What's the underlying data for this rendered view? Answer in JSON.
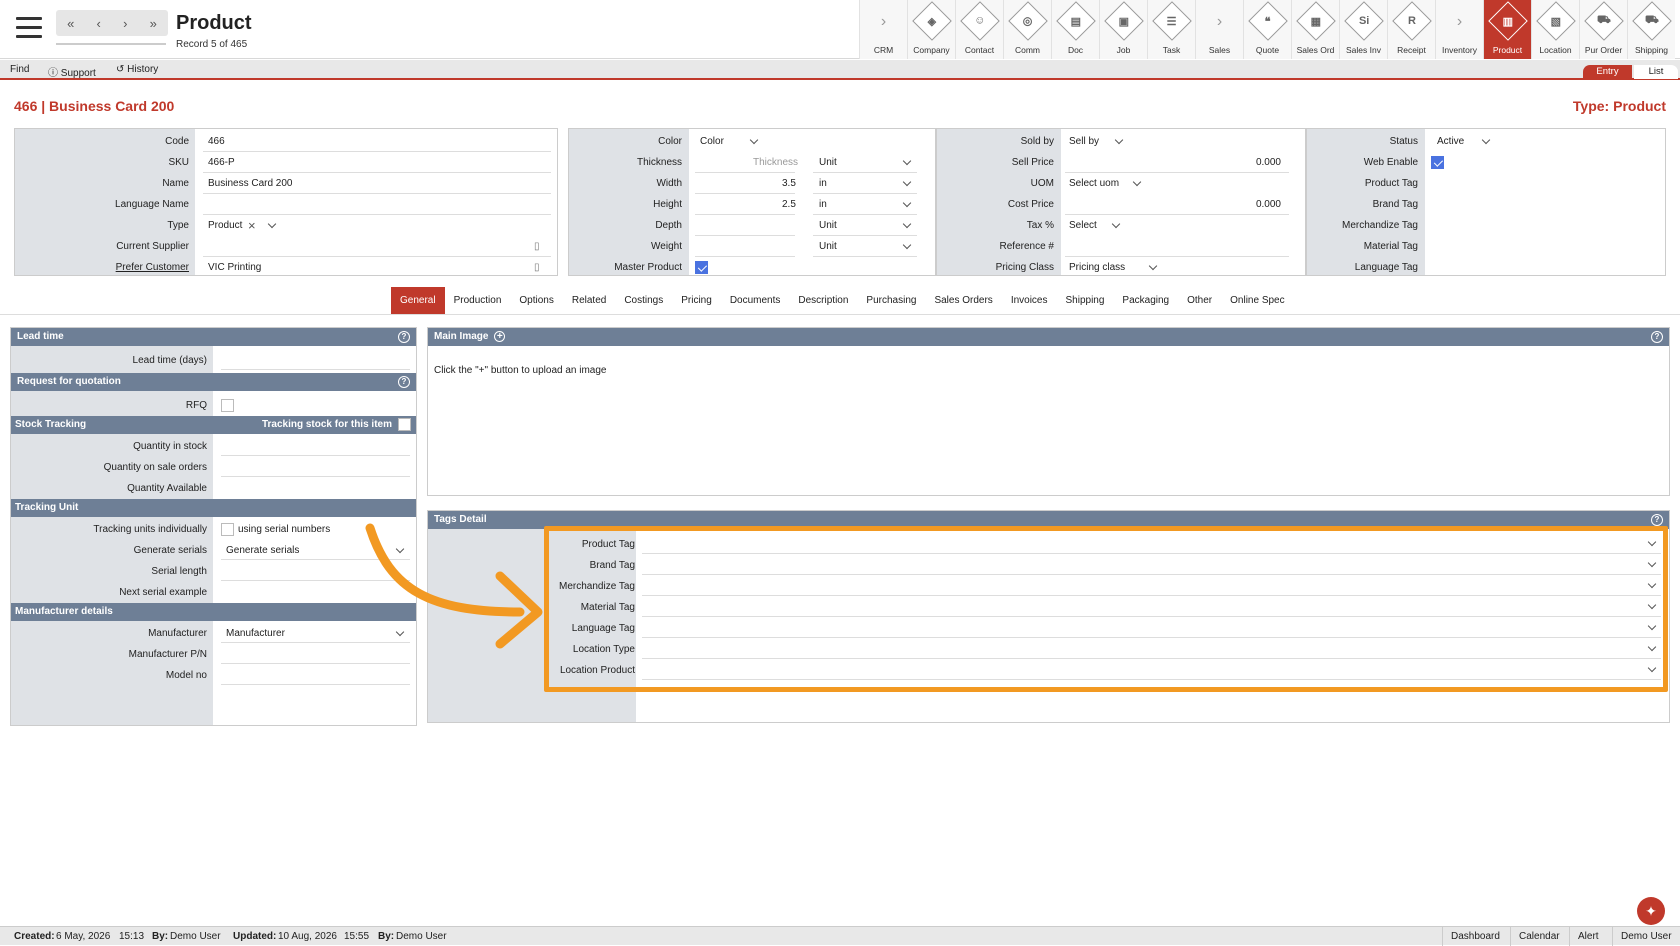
{
  "header": {
    "title": "Product",
    "record": "Record 5 of 465",
    "nav": {
      "first": "«",
      "prev": "‹",
      "next": "›",
      "last": "»"
    }
  },
  "modules": [
    {
      "label": "CRM",
      "type": "arrow",
      "glyph": "›"
    },
    {
      "label": "Company",
      "glyph": "◈"
    },
    {
      "label": "Contact",
      "glyph": "☺"
    },
    {
      "label": "Comm",
      "glyph": "◎"
    },
    {
      "label": "Doc",
      "glyph": "▤"
    },
    {
      "label": "Job",
      "glyph": "▣"
    },
    {
      "label": "Task",
      "glyph": "☰"
    },
    {
      "label": "Sales",
      "type": "arrow",
      "glyph": "›"
    },
    {
      "label": "Quote",
      "glyph": "❝"
    },
    {
      "label": "Sales Ord",
      "glyph": "▦"
    },
    {
      "label": "Sales Inv",
      "glyph": "Si"
    },
    {
      "label": "Receipt",
      "glyph": "R"
    },
    {
      "label": "Inventory",
      "type": "arrow",
      "glyph": "›"
    },
    {
      "label": "Product",
      "glyph": "▥",
      "active": true
    },
    {
      "label": "Location",
      "glyph": "▧"
    },
    {
      "label": "Pur Order",
      "glyph": "⛟"
    },
    {
      "label": "Shipping",
      "glyph": "⛟"
    }
  ],
  "toolbar": {
    "find": "Find",
    "support": "Support",
    "history": "History",
    "support_icon": "ⓘ",
    "history_icon": "↺",
    "entry": "Entry",
    "list": "List"
  },
  "record": {
    "title": "466 | Business Card 200",
    "type": "Type: Product"
  },
  "panel1": {
    "code_label": "Code",
    "code": "466",
    "sku_label": "SKU",
    "sku": "466-P",
    "name_label": "Name",
    "name": "Business Card 200",
    "language_label": "Language Name",
    "language": "",
    "type_label": "Type",
    "type": "Product",
    "type_clear": "×",
    "supplier_label": "Current Supplier",
    "supplier": "",
    "customer_label": "Prefer Customer",
    "customer": "VIC Printing"
  },
  "panel2": {
    "color_label": "Color",
    "color": "Color",
    "thickness_label": "Thickness",
    "thickness_placeholder": "Thickness",
    "thickness_unit": "Unit",
    "width_label": "Width",
    "width": "3.5",
    "width_unit": "in",
    "height_label": "Height",
    "height": "2.5",
    "height_unit": "in",
    "depth_label": "Depth",
    "depth_unit": "Unit",
    "weight_label": "Weight",
    "weight_unit": "Unit",
    "master_label": "Master Product"
  },
  "panel3": {
    "soldby_label": "Sold by",
    "soldby": "Sell by",
    "sellprice_label": "Sell Price",
    "sellprice": "0.000",
    "uom_label": "UOM",
    "uom": "Select uom",
    "costprice_label": "Cost Price",
    "costprice": "0.000",
    "tax_label": "Tax %",
    "tax": "Select",
    "ref_label": "Reference #",
    "pricing_label": "Pricing Class",
    "pricing": "Pricing class"
  },
  "panel4": {
    "status_label": "Status",
    "status": "Active",
    "web_label": "Web Enable",
    "product_tag_label": "Product Tag",
    "brand_tag_label": "Brand Tag",
    "merch_tag_label": "Merchandize Tag",
    "material_tag_label": "Material Tag",
    "language_tag_label": "Language Tag"
  },
  "tabs": [
    "General",
    "Production",
    "Options",
    "Related",
    "Costings",
    "Pricing",
    "Documents",
    "Description",
    "Purchasing",
    "Sales Orders",
    "Invoices",
    "Shipping",
    "Packaging",
    "Other",
    "Online Spec"
  ],
  "left": {
    "lead_sec": "Lead time",
    "lead_label": "Lead time (days)",
    "rfq_sec": "Request for quotation",
    "rfq_label": "RFQ",
    "stock_sec": "Stock Tracking",
    "stock_track": "Tracking stock for this item",
    "qty_stock": "Quantity in stock",
    "qty_sale": "Quantity on sale orders",
    "qty_avail": "Quantity Available",
    "unit_sec": "Tracking Unit",
    "track_ind": "Tracking units individually",
    "serial_text": "using serial numbers",
    "gen_label": "Generate serials",
    "gen_value": "Generate serials",
    "serial_len": "Serial length",
    "next_serial": "Next serial example",
    "mfr_sec": "Manufacturer details",
    "mfr_label": "Manufacturer",
    "mfr_value": "Manufacturer",
    "mfr_pn": "Manufacturer P/N",
    "model_no": "Model no",
    "help": "?"
  },
  "image": {
    "title": "Main Image",
    "add": "+",
    "hint": "Click the \"+\" button to upload an image",
    "help": "?"
  },
  "tags": {
    "title": "Tags Detail",
    "help": "?",
    "rows": [
      "Product Tag",
      "Brand Tag",
      "Merchandize Tag",
      "Material Tag",
      "Language Tag",
      "Location Type",
      "Location Product"
    ]
  },
  "status": {
    "created_label": "Created:",
    "created": "6 May, 2026",
    "created_time": "15:13",
    "by_label": "By:",
    "created_by": "Demo User",
    "updated_label": "Updated:",
    "updated": "10 Aug, 2026",
    "updated_time": "15:55",
    "updated_by": "Demo User",
    "links": [
      "Dashboard",
      "Calendar",
      "Alert",
      "Demo User"
    ]
  },
  "fab": "✦",
  "colors": {
    "accent": "#c0392b",
    "section": "#6e7f96",
    "label_bg": "#dfe2e6",
    "highlight": "#f29922",
    "check": "#4a72e0"
  }
}
